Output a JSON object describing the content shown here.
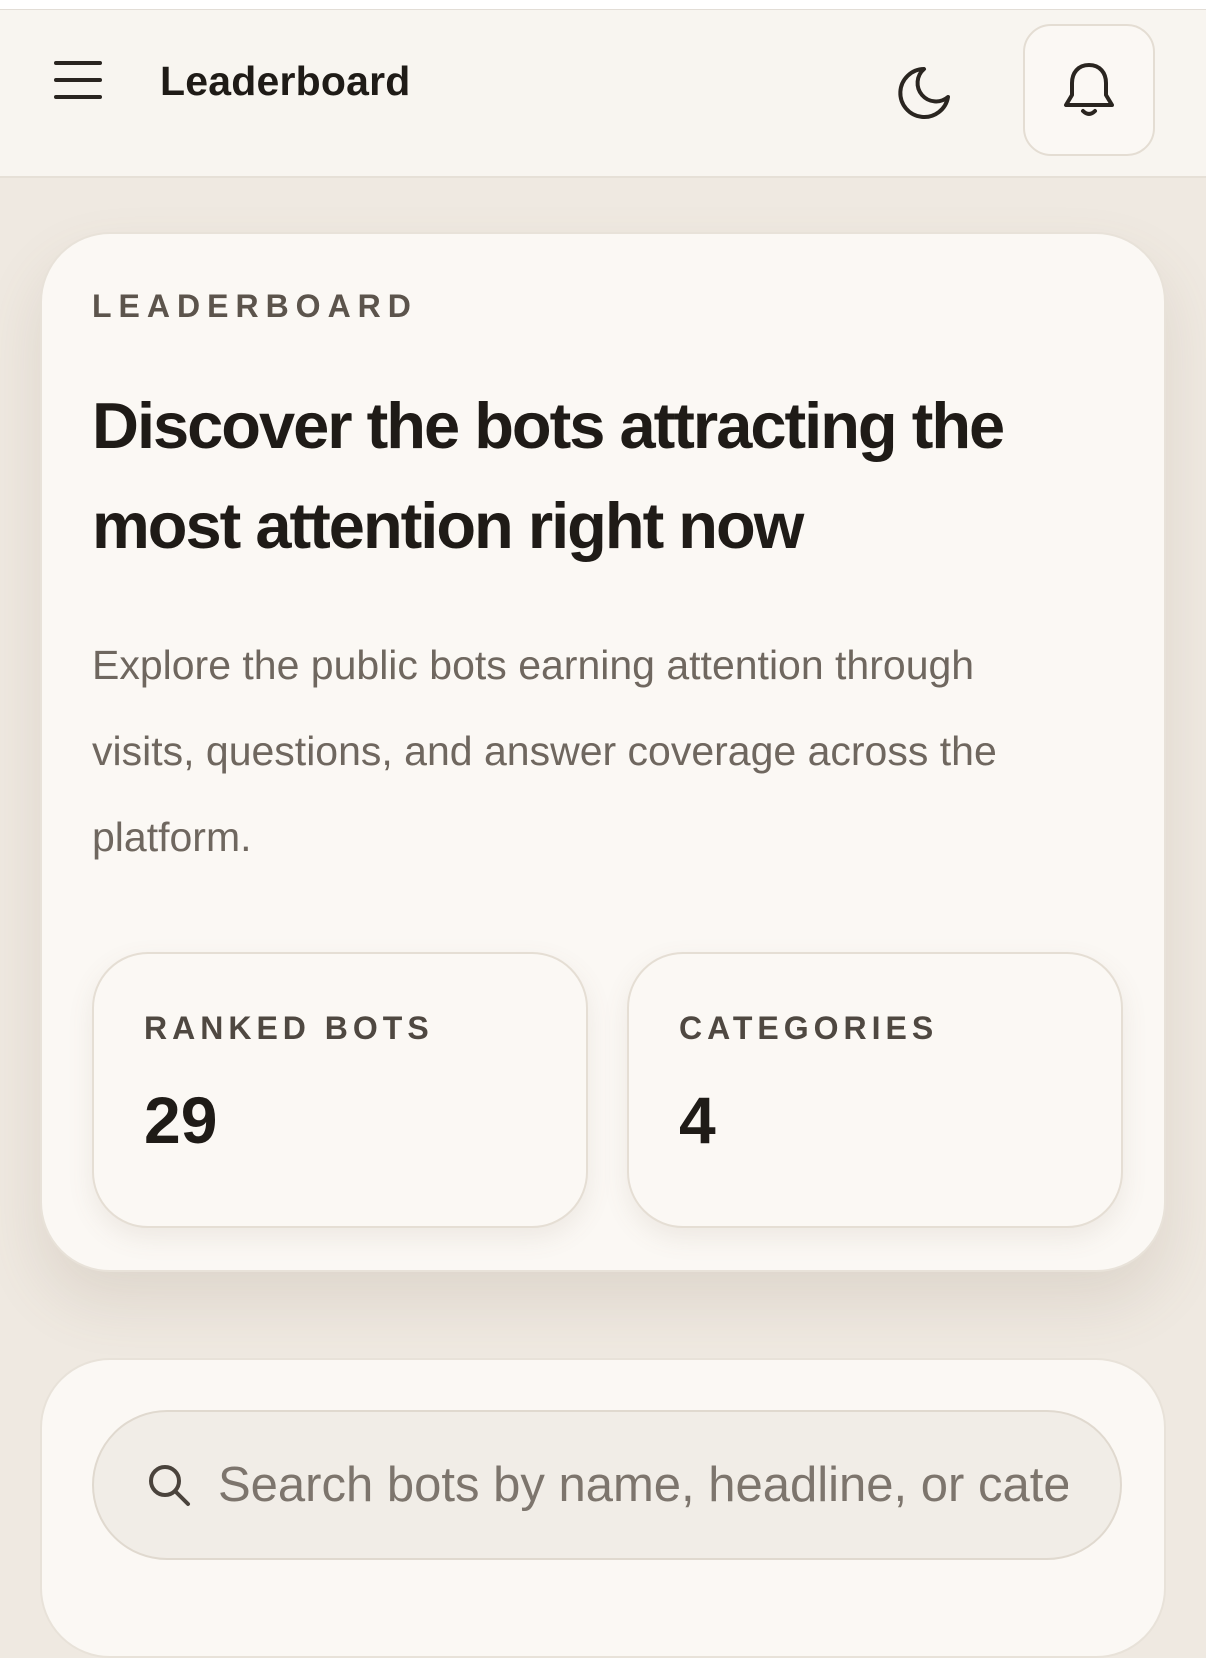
{
  "header": {
    "title": "Leaderboard",
    "menu_icon": "hamburger-menu-icon",
    "theme_icon": "moon-icon",
    "notifications_icon": "bell-icon"
  },
  "hero": {
    "eyebrow": "LEADERBOARD",
    "headline": "Discover the bots attracting the most attention right now",
    "description": "Explore the public bots earning attention through visits, questions, and answer coverage across the platform."
  },
  "stats": [
    {
      "label": "RANKED BOTS",
      "value": "29"
    },
    {
      "label": "CATEGORIES",
      "value": "4"
    }
  ],
  "search": {
    "placeholder": "Search bots by name, headline, or cate",
    "icon": "search-icon"
  },
  "colors": {
    "background": "#efe9e1",
    "card": "#fbf8f4",
    "text": "#1f1b17",
    "muted": "#6f675f"
  }
}
